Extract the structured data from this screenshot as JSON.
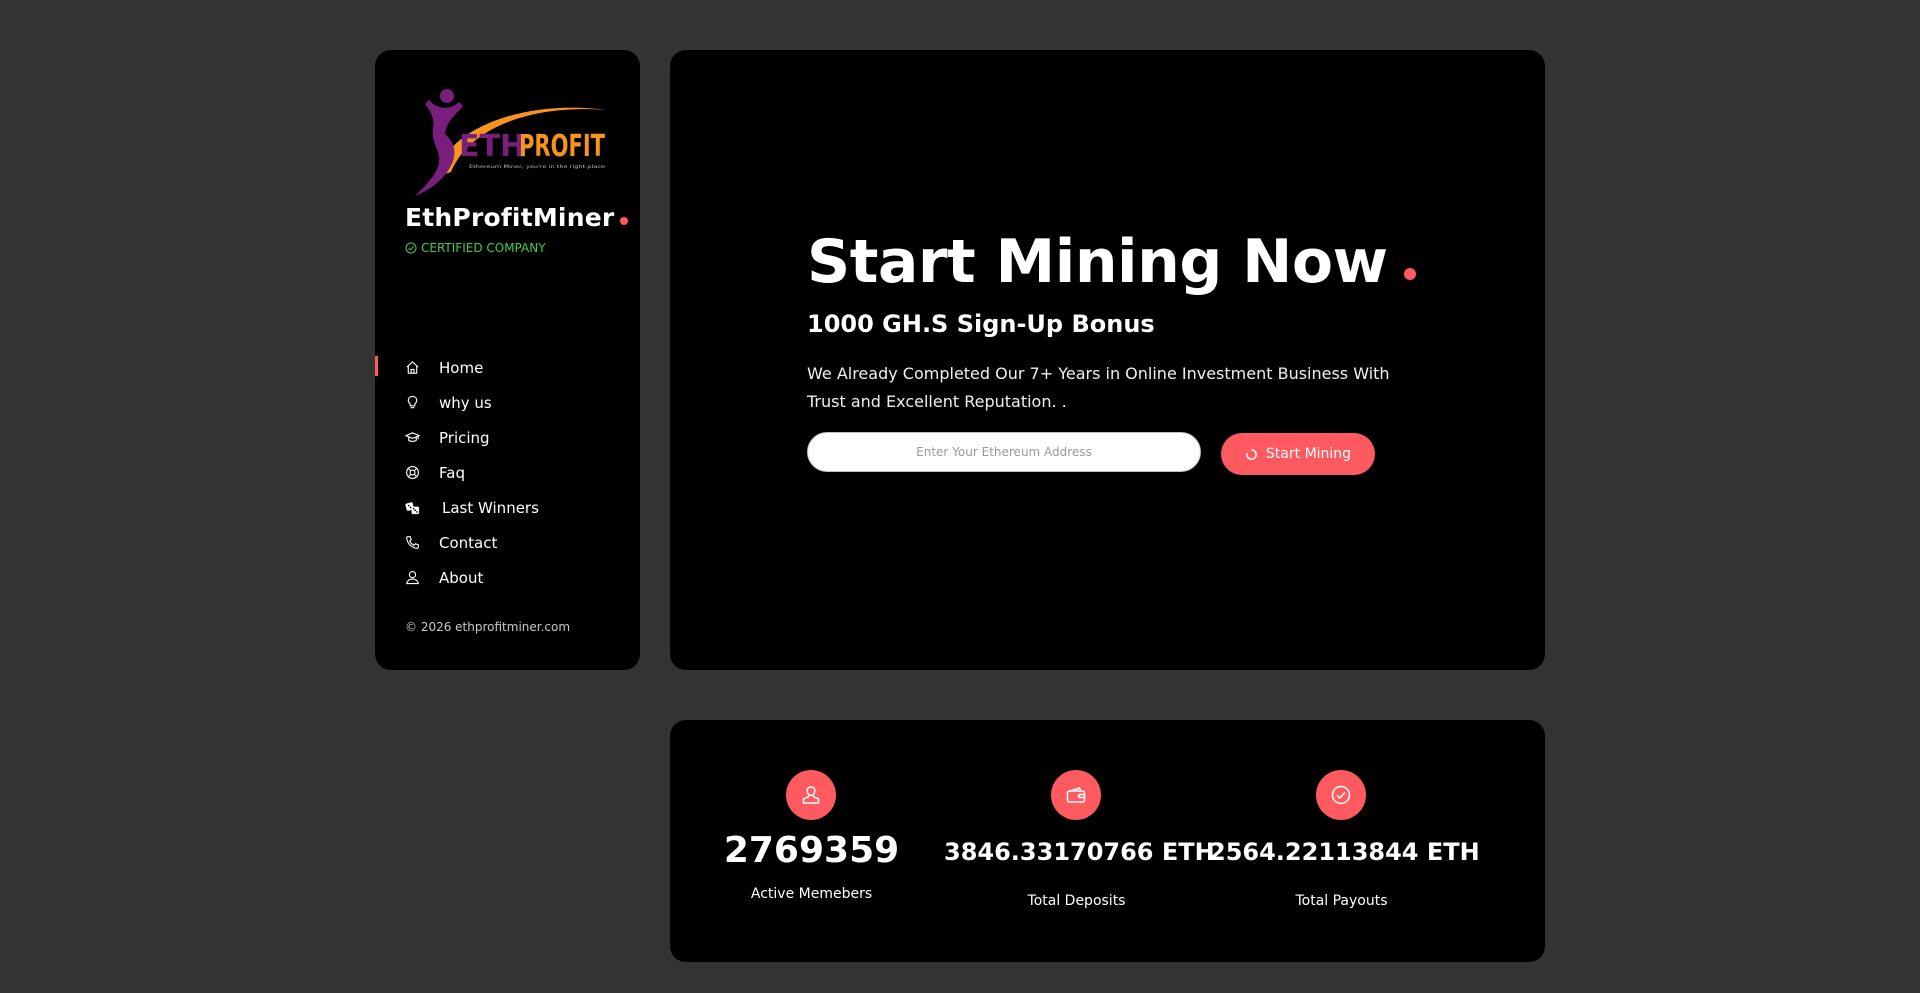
{
  "sidebar": {
    "logo": {
      "text_eth": "ETH",
      "text_profit": "PROFIT",
      "tagline": "Ethereum Miner, you're in the right place"
    },
    "brand": "EthProfitMiner",
    "certified": "CERTIFIED COMPANY",
    "nav": [
      {
        "label": "Home",
        "icon": "home-icon"
      },
      {
        "label": "why us",
        "icon": "lightbulb-icon"
      },
      {
        "label": "Pricing",
        "icon": "graduation-cap-icon"
      },
      {
        "label": "Faq",
        "icon": "lifebuoy-icon"
      },
      {
        "label": "Last Winners",
        "icon": "dice-icon"
      },
      {
        "label": "Contact",
        "icon": "phone-icon"
      },
      {
        "label": "About",
        "icon": "user-icon"
      }
    ],
    "active_nav": "Home",
    "copyright": "© 2026 ethprofitminer.com"
  },
  "hero": {
    "title": "Start Mining Now",
    "subtitle": "1000 GH.S Sign-Up Bonus",
    "description": "We Already Completed Our 7+ Years in Online Investment Business With Trust and Excellent Reputation. .",
    "input_placeholder": "Enter Your Ethereum Address",
    "input_value": "",
    "button_label": "Start Mining"
  },
  "stats": [
    {
      "value": "2769359",
      "label": "Active Memebers",
      "icon": "user-icon"
    },
    {
      "value": "3846.33170766 ETH",
      "label": "Total Deposits",
      "icon": "wallet-icon"
    },
    {
      "value": "2564.22113844 ETH",
      "label": "Total Payouts",
      "icon": "check-circle-icon"
    }
  ],
  "colors": {
    "page_background": "#333333",
    "card_background": "#000000",
    "accent": "#ff5a5f",
    "certified": "#3ecf4a",
    "logo_purple": "#7a1e7e",
    "logo_orange": "#f7941d"
  }
}
